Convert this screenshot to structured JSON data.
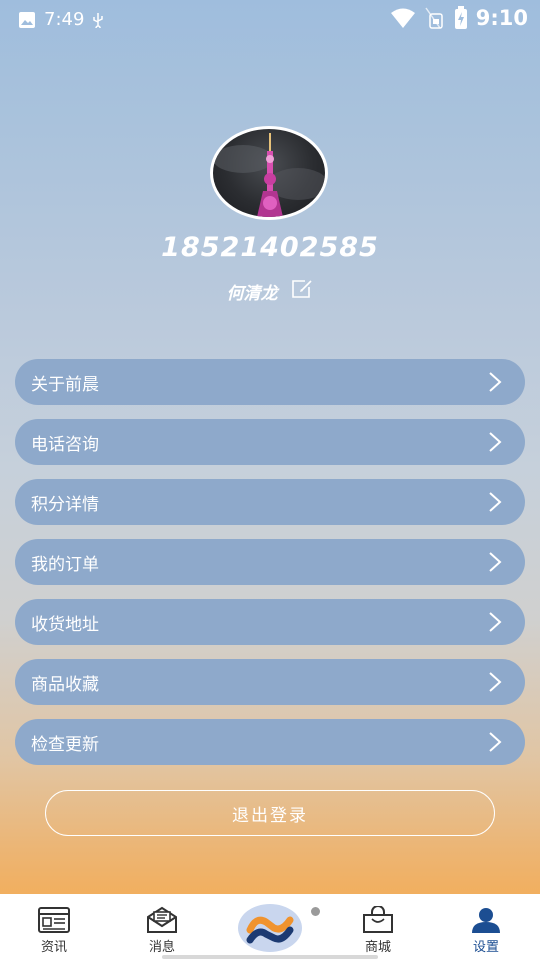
{
  "status_bar": {
    "time_left": "7:49",
    "time_right": "9:10",
    "icons": [
      "image-icon",
      "usb-icon",
      "wifi-icon",
      "sim-icon",
      "battery-charging-icon"
    ]
  },
  "profile": {
    "phone": "18521402585",
    "nickname": "何清龙",
    "avatar": "tower-night-photo"
  },
  "menu": [
    {
      "label": "关于前晨"
    },
    {
      "label": "电话咨询"
    },
    {
      "label": "积分详情"
    },
    {
      "label": "我的订单"
    },
    {
      "label": "收货地址"
    },
    {
      "label": "商品收藏"
    },
    {
      "label": "检查更新"
    }
  ],
  "logout_label": "退出登录",
  "tabbar": [
    {
      "label": "资讯",
      "icon": "news-icon"
    },
    {
      "label": "消息",
      "icon": "mail-icon"
    },
    {
      "label": "",
      "icon": "app-logo-icon"
    },
    {
      "label": "商城",
      "icon": "shopping-bag-icon"
    },
    {
      "label": "设置",
      "icon": "user-icon",
      "active": true
    }
  ],
  "colors": {
    "menu_bg": "#8ea9cb",
    "active_tab": "#1c4e92",
    "logo_orange": "#f0932e",
    "logo_navy": "#1c3a72"
  }
}
